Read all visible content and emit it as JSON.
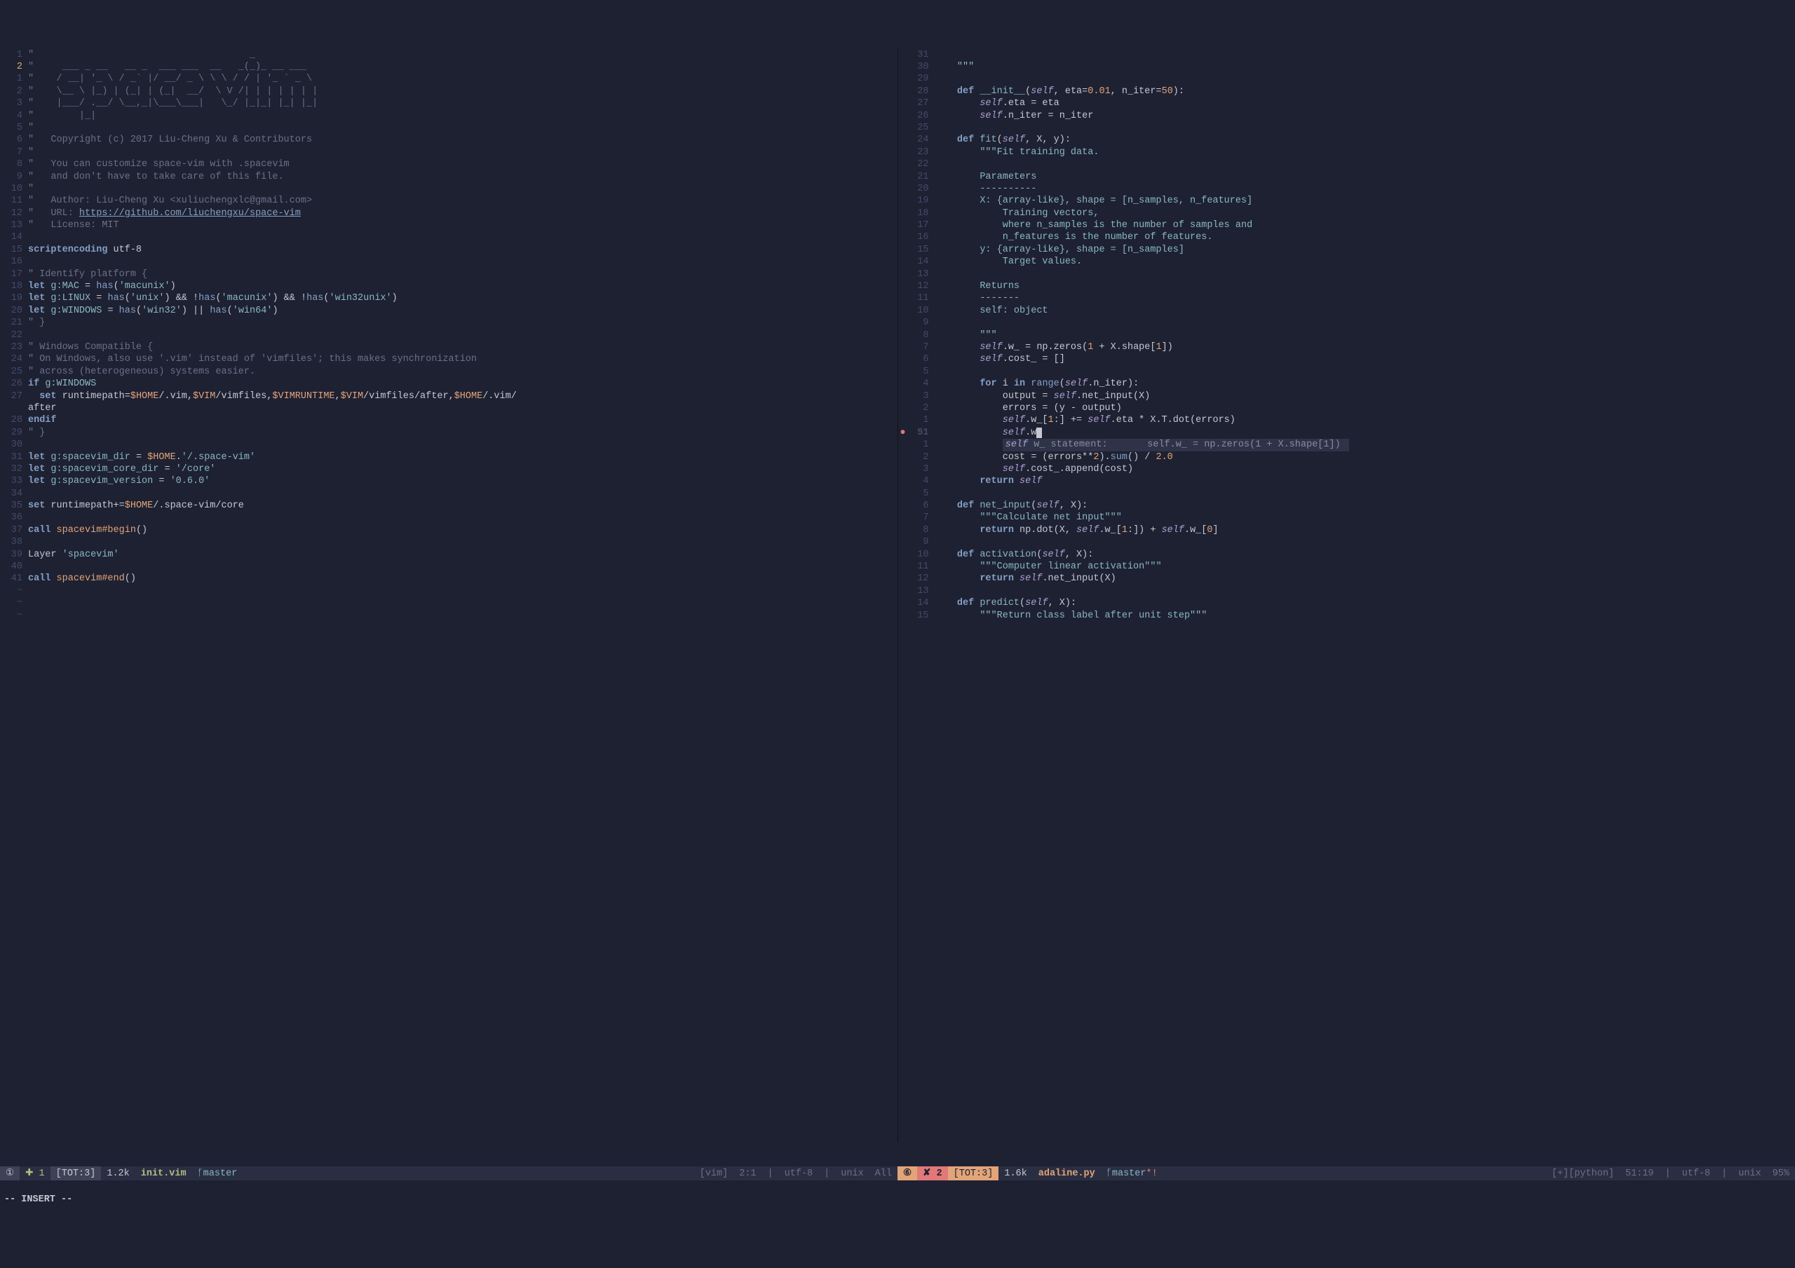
{
  "left_pane": {
    "lines": [
      {
        "n": "1",
        "cls": "comment",
        "text": "\"                                      _"
      },
      {
        "n": "2",
        "cls": "comment",
        "text": "\"     ___ _ __   __ _  ___ ___  __   _(_)_ __ ___",
        "cursor": true
      },
      {
        "n": "1",
        "cls": "comment",
        "text": "\"    / __| '_ \\ / _` |/ __/ _ \\ \\ \\ / / | '_ ` _ \\"
      },
      {
        "n": "2",
        "cls": "comment",
        "text": "\"    \\__ \\ |_) | (_| | (_|  __/  \\ V /| | | | | | |"
      },
      {
        "n": "3",
        "cls": "comment",
        "text": "\"    |___/ .__/ \\__,_|\\___\\___|   \\_/ |_|_| |_| |_|"
      },
      {
        "n": "4",
        "cls": "comment",
        "text": "\"        |_|"
      },
      {
        "n": "5",
        "cls": "comment",
        "text": "\""
      },
      {
        "n": "6",
        "cls": "comment",
        "text": "\"   Copyright (c) 2017 Liu-Cheng Xu & Contributors"
      },
      {
        "n": "7",
        "cls": "comment",
        "text": "\""
      },
      {
        "n": "8",
        "cls": "comment",
        "text": "\"   You can customize space-vim with .spacevim"
      },
      {
        "n": "9",
        "cls": "comment",
        "text": "\"   and don't have to take care of this file."
      },
      {
        "n": "10",
        "cls": "comment",
        "text": "\""
      },
      {
        "n": "11",
        "cls": "comment",
        "text_html": "<span class='comment'>\"   Author: Liu-Cheng Xu &lt;xuliuchengxlc@gmail.com&gt;</span>"
      },
      {
        "n": "12",
        "cls": "comment",
        "text_html": "<span class='comment'>\"   URL: </span><span class='url'>https://github.com/liuchengxu/space-vim</span>"
      },
      {
        "n": "13",
        "cls": "comment",
        "text": "\"   License: MIT"
      },
      {
        "n": "14",
        "cls": "",
        "text": ""
      },
      {
        "n": "15",
        "cls": "",
        "text_html": "<span class='keyword'>scriptencoding</span> <span class='ident'>utf-8</span>"
      },
      {
        "n": "16",
        "cls": "",
        "text": ""
      },
      {
        "n": "17",
        "cls": "comment",
        "text": "\" Identify platform {"
      },
      {
        "n": "18",
        "cls": "",
        "text_html": "<span class='keyword'>let</span> <span class='var'>g:MAC</span> <span class='op'>=</span> <span class='call'>has</span>(<span class='string'>'macunix'</span>)"
      },
      {
        "n": "19",
        "cls": "",
        "text_html": "<span class='keyword'>let</span> <span class='var'>g:LINUX</span> <span class='op'>=</span> <span class='call'>has</span>(<span class='string'>'unix'</span>) <span class='op'>&amp;&amp;</span> <span class='op'>!</span><span class='call'>has</span>(<span class='string'>'macunix'</span>) <span class='op'>&amp;&amp;</span> <span class='op'>!</span><span class='call'>has</span>(<span class='string'>'win32unix'</span>)"
      },
      {
        "n": "20",
        "cls": "",
        "text_html": "<span class='keyword'>let</span> <span class='var'>g:WINDOWS</span> <span class='op'>=</span> <span class='call'>has</span>(<span class='string'>'win32'</span>) <span class='op'>||</span> <span class='call'>has</span>(<span class='string'>'win64'</span>)"
      },
      {
        "n": "21",
        "cls": "comment",
        "text": "\" }"
      },
      {
        "n": "22",
        "cls": "",
        "text": ""
      },
      {
        "n": "23",
        "cls": "comment",
        "text": "\" Windows Compatible {"
      },
      {
        "n": "24",
        "cls": "comment",
        "text": "\" On Windows, also use '.vim' instead of 'vimfiles'; this makes synchronization"
      },
      {
        "n": "25",
        "cls": "comment",
        "text": "\" across (heterogeneous) systems easier."
      },
      {
        "n": "26",
        "cls": "",
        "text_html": "<span class='keyword'>if</span> <span class='var'>g:WINDOWS</span>"
      },
      {
        "n": "27",
        "cls": "",
        "text_html": "  <span class='keyword'>set</span> <span class='ident'>runtimepath</span><span class='op'>=</span><span class='const'>$HOME</span>/.vim,<span class='const'>$VIM</span>/vimfiles,<span class='const'>$VIMRUNTIME</span>,<span class='const'>$VIM</span>/vimfiles/after,<span class='const'>$HOME</span>/.vim/"
      },
      {
        "n": "",
        "cls": "",
        "text": "after"
      },
      {
        "n": "28",
        "cls": "",
        "text_html": "<span class='keyword'>endif</span>"
      },
      {
        "n": "29",
        "cls": "comment",
        "text": "\" }"
      },
      {
        "n": "30",
        "cls": "",
        "text": ""
      },
      {
        "n": "31",
        "cls": "",
        "text_html": "<span class='keyword'>let</span> <span class='var'>g:spacevim_dir</span> <span class='op'>=</span> <span class='const'>$HOME</span>.<span class='string'>'/.space-vim'</span>"
      },
      {
        "n": "32",
        "cls": "",
        "text_html": "<span class='keyword'>let</span> <span class='var'>g:spacevim_core_dir</span> <span class='op'>=</span> <span class='string'>'/core'</span>"
      },
      {
        "n": "33",
        "cls": "",
        "text_html": "<span class='keyword'>let</span> <span class='var'>g:spacevim_version</span> <span class='op'>=</span> <span class='string'>'0.6.0'</span>"
      },
      {
        "n": "34",
        "cls": "",
        "text": ""
      },
      {
        "n": "35",
        "cls": "",
        "text_html": "<span class='keyword'>set</span> <span class='ident'>runtimepath</span><span class='op'>+=</span><span class='const'>$HOME</span>/.space-vim/core"
      },
      {
        "n": "36",
        "cls": "",
        "text": ""
      },
      {
        "n": "37",
        "cls": "",
        "text_html": "<span class='keyword'>call</span> <span class='func'>spacevim#begin</span>()"
      },
      {
        "n": "38",
        "cls": "",
        "text": ""
      },
      {
        "n": "39",
        "cls": "",
        "text_html": "<span class='ident'>Layer</span> <span class='string'>'spacevim'</span>"
      },
      {
        "n": "40",
        "cls": "",
        "text": ""
      },
      {
        "n": "41",
        "cls": "",
        "text_html": "<span class='keyword'>call</span> <span class='func'>spacevim#end</span>()"
      }
    ],
    "status": {
      "warn_icon": "①",
      "warn_count": "✚ 1",
      "tot": "[TOT:3]",
      "size": "1.2k",
      "filename": "init.vim",
      "branch_icon": "ᚶ",
      "branch": "master",
      "filetype": "[vim]",
      "pos": "2:1",
      "encoding": "utf-8",
      "fileformat": "unix",
      "percent": "All"
    }
  },
  "right_pane": {
    "lines": [
      {
        "n": "31",
        "text_html": ""
      },
      {
        "n": "30",
        "text_html": "    <span class='string'>\"\"\"</span>"
      },
      {
        "n": "29",
        "text_html": ""
      },
      {
        "n": "28",
        "text_html": "    <span class='def'>def</span> <span class='pyfunc'>__init__</span>(<span class='self'>self</span>, eta=<span class='number'>0.01</span>, n_iter=<span class='number'>50</span>):"
      },
      {
        "n": "27",
        "text_html": "        <span class='self'>self</span>.eta = eta"
      },
      {
        "n": "26",
        "text_html": "        <span class='self'>self</span>.n_iter = n_iter"
      },
      {
        "n": "25",
        "text_html": ""
      },
      {
        "n": "24",
        "text_html": "    <span class='def'>def</span> <span class='pyfunc'>fit</span>(<span class='self'>self</span>, X, y):"
      },
      {
        "n": "23",
        "text_html": "        <span class='string'>\"\"\"Fit training data.</span>"
      },
      {
        "n": "22",
        "text_html": ""
      },
      {
        "n": "21",
        "text_html": "        <span class='string'>Parameters</span>"
      },
      {
        "n": "20",
        "text_html": "        <span class='string'>----------</span>"
      },
      {
        "n": "19",
        "text_html": "        <span class='string'>X: {array-like}, shape = [n_samples, n_features]</span>"
      },
      {
        "n": "18",
        "text_html": "            <span class='string'>Training vectors,</span>"
      },
      {
        "n": "17",
        "text_html": "            <span class='string'>where n_samples is the number of samples and</span>"
      },
      {
        "n": "16",
        "text_html": "            <span class='string'>n_features is the number of features.</span>"
      },
      {
        "n": "15",
        "text_html": "        <span class='string'>y: {array-like}, shape = [n_samples]</span>"
      },
      {
        "n": "14",
        "text_html": "            <span class='string'>Target values.</span>"
      },
      {
        "n": "13",
        "text_html": ""
      },
      {
        "n": "12",
        "text_html": "        <span class='string'>Returns</span>"
      },
      {
        "n": "11",
        "text_html": "        <span class='string'>-------</span>"
      },
      {
        "n": "10",
        "text_html": "        <span class='string'>self: object</span>"
      },
      {
        "n": "9",
        "text_html": ""
      },
      {
        "n": "8",
        "text_html": "        <span class='string'>\"\"\"</span>"
      },
      {
        "n": "7",
        "text_html": "        <span class='self'>self</span>.w_ = np.zeros(<span class='number'>1</span> + X.shape[<span class='number'>1</span>])"
      },
      {
        "n": "6",
        "text_html": "        <span class='self'>self</span>.cost_ = []"
      },
      {
        "n": "5",
        "text_html": ""
      },
      {
        "n": "4",
        "text_html": "        <span class='keyword'>for</span> i <span class='keyword'>in</span> <span class='call'>range</span>(<span class='self'>self</span>.n_iter):"
      },
      {
        "n": "3",
        "text_html": "            output = <span class='self'>self</span>.net_input(X)"
      },
      {
        "n": "2",
        "text_html": "            errors = (y - output)"
      },
      {
        "n": "1",
        "text_html": "            <span class='self'>self</span>.w_[<span class='number'>1</span>:] += <span class='self'>self</span>.eta * X.T.dot(errors)"
      },
      {
        "n": "51",
        "text_html": "            <span class='self'>self</span>.w<span style='background:#c6c8d1;color:#1e2132'> </span>",
        "cursor": true,
        "marker": "●"
      },
      {
        "n": "1",
        "text_html": "            <span class='completion'><span class='self'>self</span> w_ statement:       self.w_ = np.zeros(1 + X.shape[1]) </span>",
        "is_completion": true
      },
      {
        "n": "2",
        "text_html": "            cost = (errors**<span class='number'>2</span>).<span class='call'>sum</span>() / <span class='number'>2.0</span>"
      },
      {
        "n": "3",
        "text_html": "            <span class='self'>self</span>.cost_.append(cost)"
      },
      {
        "n": "4",
        "text_html": "        <span class='keyword'>return</span> <span class='self'>self</span>"
      },
      {
        "n": "5",
        "text_html": ""
      },
      {
        "n": "6",
        "text_html": "    <span class='def'>def</span> <span class='pyfunc'>net_input</span>(<span class='self'>self</span>, X):"
      },
      {
        "n": "7",
        "text_html": "        <span class='string'>\"\"\"Calculate net input\"\"\"</span>"
      },
      {
        "n": "8",
        "text_html": "        <span class='keyword'>return</span> np.dot(X, <span class='self'>self</span>.w_[<span class='number'>1</span>:]) + <span class='self'>self</span>.w_[<span class='number'>0</span>]"
      },
      {
        "n": "9",
        "text_html": ""
      },
      {
        "n": "10",
        "text_html": "    <span class='def'>def</span> <span class='pyfunc'>activation</span>(<span class='self'>self</span>, X):"
      },
      {
        "n": "11",
        "text_html": "        <span class='string'>\"\"\"Computer linear activation\"\"\"</span>"
      },
      {
        "n": "12",
        "text_html": "        <span class='keyword'>return</span> <span class='self'>self</span>.net_input(X)"
      },
      {
        "n": "13",
        "text_html": ""
      },
      {
        "n": "14",
        "text_html": "    <span class='def'>def</span> <span class='pyfunc'>predict</span>(<span class='self'>self</span>, X):"
      },
      {
        "n": "15",
        "text_html": "        <span class='string'>\"\"\"Return class label after unit step\"\"\"</span>"
      }
    ],
    "status": {
      "warn_icon": "⑥",
      "err_icon": "✘ 2",
      "tot": "[TOT:3]",
      "size": "1.6k",
      "filename": "adaline.py",
      "branch_icon": "ᚶ",
      "branch": "master",
      "flags": "*!",
      "modified": "[+]",
      "filetype": "[python]",
      "pos": "51:19",
      "encoding": "utf-8",
      "fileformat": "unix",
      "percent": "95%"
    }
  },
  "mode": "-- INSERT --"
}
